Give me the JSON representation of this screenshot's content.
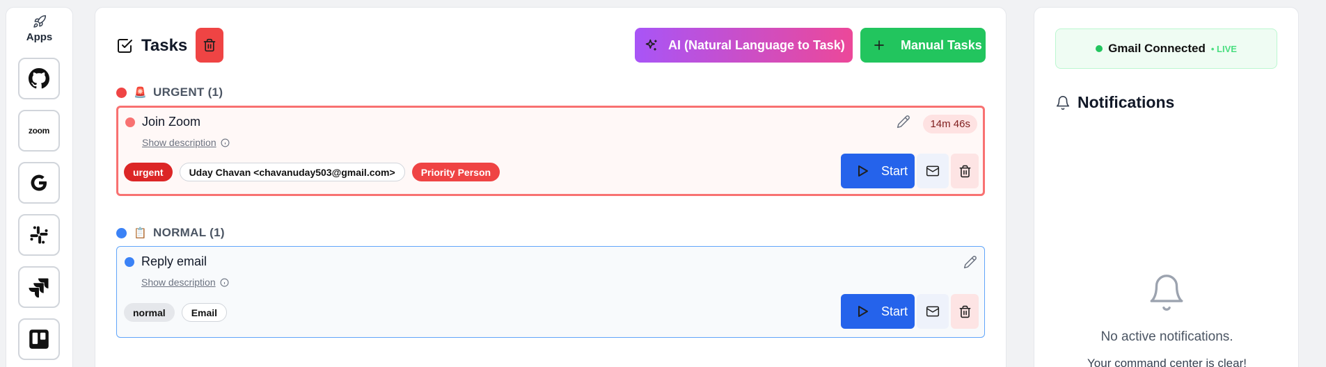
{
  "apps": {
    "label": "Apps",
    "tiles": [
      {
        "name": "github",
        "icon": "github-icon"
      },
      {
        "name": "zoom",
        "text": "zoom"
      },
      {
        "name": "google",
        "icon": "google-icon"
      },
      {
        "name": "slack",
        "icon": "slack-icon"
      },
      {
        "name": "jira",
        "icon": "jira-icon"
      },
      {
        "name": "trello",
        "icon": "trello-icon"
      }
    ]
  },
  "tasks": {
    "title": "Tasks",
    "ai_button": "AI (Natural Language to Task)",
    "manual_button": "Manual Tasks",
    "sections": [
      {
        "label": "URGENT (1)",
        "emoji": "🚨",
        "dot_color": "#ef4444",
        "items": [
          {
            "title": "Join Zoom",
            "desc_link": "Show description",
            "timer": "14m 46s",
            "tags": [
              "urgent",
              "Uday Chavan <chavanuday503@gmail.com>",
              "Priority Person"
            ],
            "start_label": "Start"
          }
        ]
      },
      {
        "label": "NORMAL (1)",
        "emoji": "📋",
        "dot_color": "#3b82f6",
        "items": [
          {
            "title": "Reply email",
            "desc_link": "Show description",
            "tags": [
              "normal",
              "Email"
            ],
            "start_label": "Start"
          }
        ]
      }
    ]
  },
  "notifications": {
    "gmail_status": "Gmail Connected",
    "live_badge": "• LIVE",
    "title": "Notifications",
    "empty_line1": "No active notifications.",
    "empty_line2": "Your command center is clear!"
  }
}
